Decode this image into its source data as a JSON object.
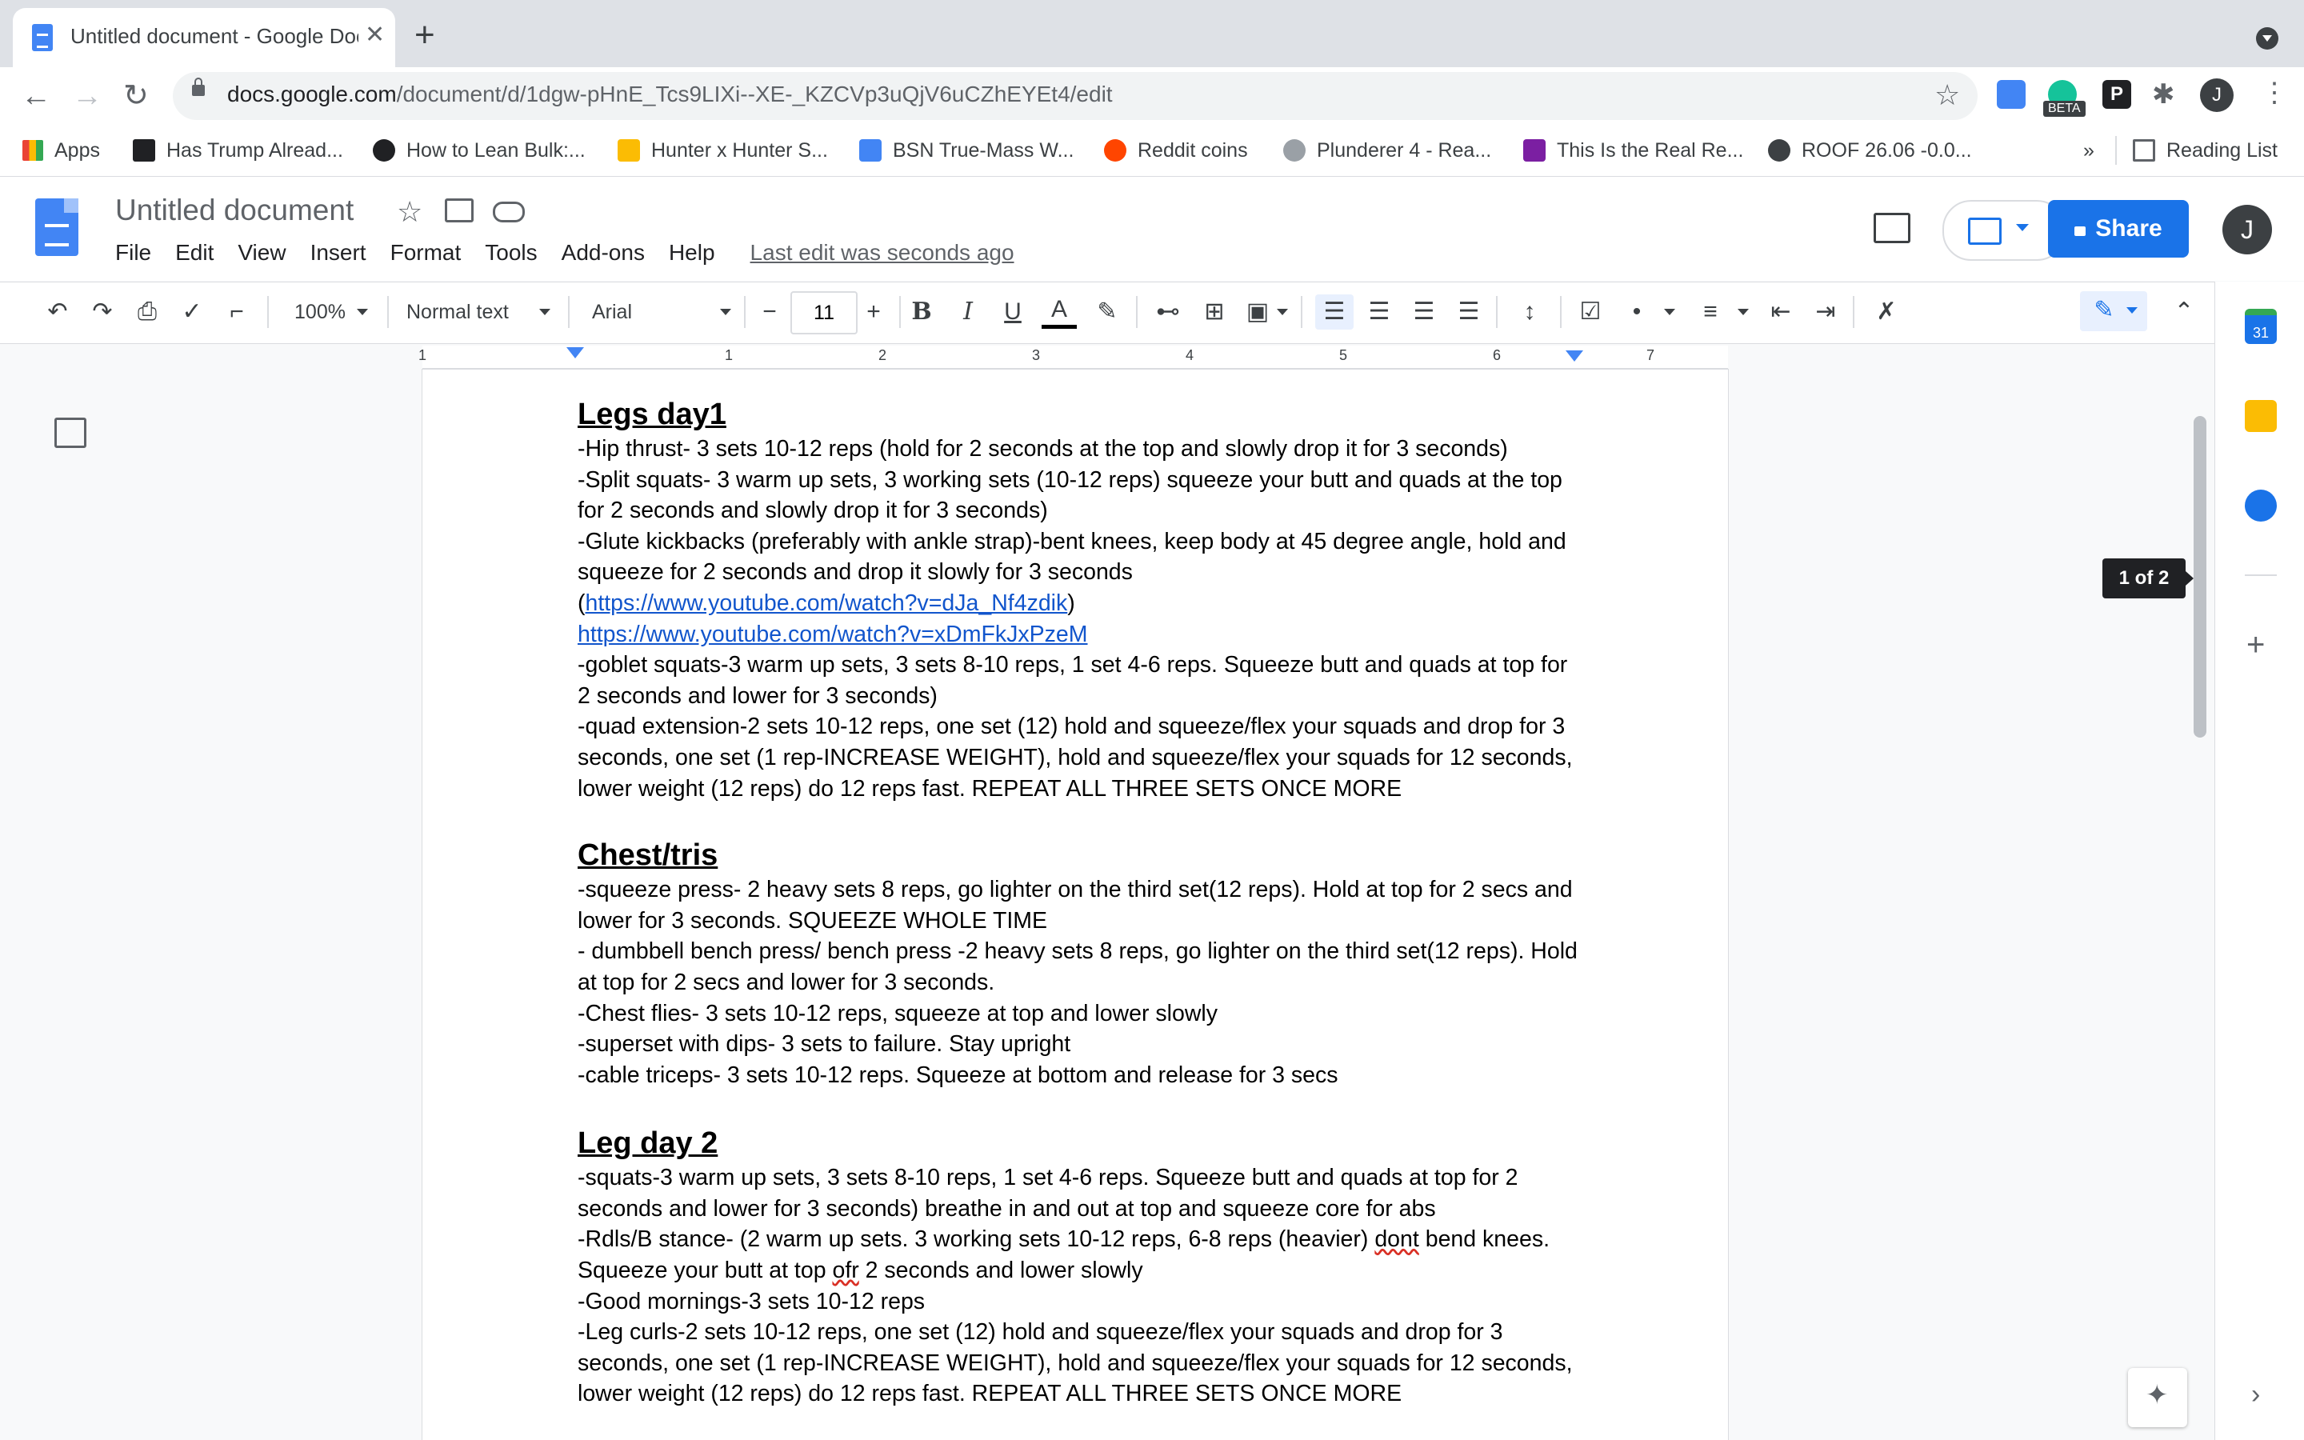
{
  "browser": {
    "tab_title": "Untitled document - Google Docs",
    "tab_close": "✕",
    "new_tab": "+",
    "url_host": "docs.google.com",
    "url_path": "/document/d/1dgw-pHnE_Tcs9LIXi--XE-_KZCVp3uQjV6uCZhEYEt4/edit",
    "extension_beta_label": "BETA",
    "extension_p_label": "P",
    "profile_initial": "J",
    "bookmarks": [
      {
        "label": "Apps",
        "color": "#ea4335"
      },
      {
        "label": "Has Trump Alread...",
        "color": "#202124"
      },
      {
        "label": "How to Lean Bulk:...",
        "color": "#202124"
      },
      {
        "label": "Hunter x Hunter S...",
        "color": "#fbbc04"
      },
      {
        "label": "BSN True-Mass W...",
        "color": "#4285f4"
      },
      {
        "label": "Reddit coins",
        "color": "#ff4500"
      },
      {
        "label": "Plunderer 4 - Rea...",
        "color": "#5f6368"
      },
      {
        "label": "This Is the Real Re...",
        "color": "#7b1fa2"
      },
      {
        "label": "ROOF 26.06 -0.0...",
        "color": "#3c4043"
      }
    ],
    "bookmarks_overflow": "»",
    "reading_list": "Reading List"
  },
  "docs_header": {
    "title": "Untitled document",
    "menu": [
      "File",
      "Edit",
      "View",
      "Insert",
      "Format",
      "Tools",
      "Add-ons",
      "Help"
    ],
    "last_edit": "Last edit was seconds ago",
    "share_label": "Share",
    "account_initial": "J"
  },
  "toolbar": {
    "zoom": "100%",
    "style": "Normal text",
    "font": "Arial",
    "font_size": "11",
    "minus": "−",
    "plus": "+",
    "bold": "B",
    "italic": "I",
    "underline": "U",
    "text_color": "A"
  },
  "ruler": {
    "numbers": [
      "1",
      "1",
      "2",
      "3",
      "4",
      "5",
      "6",
      "7"
    ]
  },
  "page_indicator": "1 of 2",
  "side_panel": {
    "calendar_day": "31",
    "add": "+",
    "expand": "›"
  },
  "document": {
    "sections": [
      {
        "heading": "Legs day1",
        "lines": [
          "-Hip thrust- 3 sets 10-12 reps (hold for 2 seconds at the top and slowly drop it for 3 seconds)",
          "-Split squats- 3 warm up sets, 3 working sets (10-12 reps) squeeze your butt and quads at the top for 2 seconds and slowly drop it for 3 seconds)",
          "-Glute kickbacks (preferably with ankle strap)-bent knees, keep body at 45 degree angle, hold and squeeze for 2 seconds and drop it slowly for 3 seconds"
        ],
        "link1_prefix": "(",
        "link1": "https://www.youtube.com/watch?v=dJa_Nf4zdik",
        "link1_suffix": ")",
        "link2": "https://www.youtube.com/watch?v=xDmFkJxPzeM",
        "lines_after": [
          "-goblet squats-3 warm up sets, 3 sets 8-10 reps, 1 set 4-6 reps. Squeeze butt and quads at top for 2 seconds and lower for 3 seconds)",
          "-quad extension-2 sets 10-12 reps, one set (12) hold and squeeze/flex your squads and drop for 3 seconds, one set (1 rep-INCREASE WEIGHT), hold and squeeze/flex your squads for 12 seconds, lower weight (12 reps) do 12 reps fast. REPEAT ALL THREE SETS ONCE MORE"
        ]
      },
      {
        "heading": "Chest/tris",
        "lines": [
          "-squeeze press- 2 heavy sets 8 reps, go lighter on the third set(12 reps). Hold at top for 2 secs and lower for 3 seconds. SQUEEZE WHOLE TIME",
          "- dumbbell bench press/ bench press -2 heavy sets 8 reps, go lighter on the third set(12 reps). Hold at top for 2 secs and lower for 3 seconds.",
          "-Chest flies- 3 sets 10-12 reps, squeeze at top and lower slowly",
          "-superset with dips- 3 sets to failure. Stay upright",
          "-cable triceps- 3 sets 10-12 reps. Squeeze at bottom and release for 3 secs"
        ]
      },
      {
        "heading": "Leg day 2",
        "line1": "-squats-3 warm up sets, 3 sets 8-10 reps, 1 set 4-6 reps. Squeeze butt and quads at top for 2 seconds and lower for 3 seconds) breathe in and out at top and squeeze core for abs",
        "line2a": "-Rdls/B stance- (2 warm up sets. 3 working sets 10-12 reps, 6-8 reps (heavier) ",
        "line2_misspelled1": "dont",
        "line2b": " bend knees. Squeeze your butt at top ",
        "line2_misspelled2": "ofr",
        "line2c": " 2 seconds and lower slowly",
        "line3": "-Good mornings-3 sets 10-12 reps",
        "line4": "-Leg curls-2 sets 10-12 reps, one set (12) hold and squeeze/flex your squads and drop for 3 seconds, one set (1 rep-INCREASE WEIGHT), hold and squeeze/flex your squads for 12 seconds, lower weight (12 reps) do 12 reps fast. REPEAT ALL THREE SETS ONCE MORE"
      }
    ]
  }
}
